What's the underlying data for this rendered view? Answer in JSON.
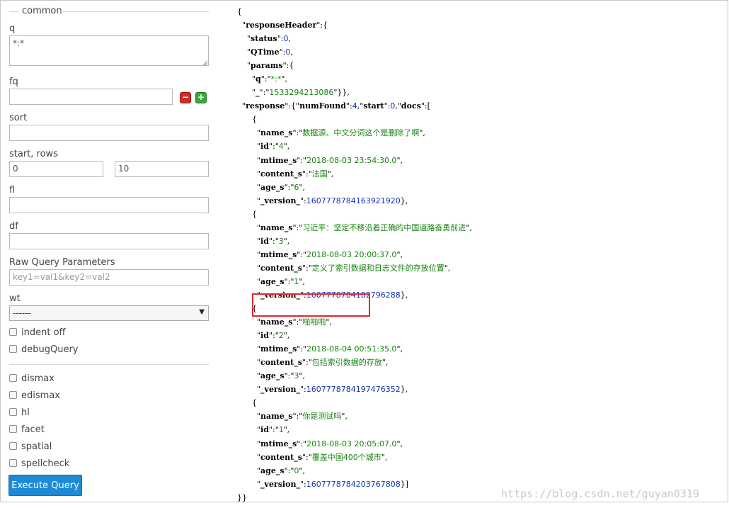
{
  "form": {
    "legend": "common",
    "q_label": "q",
    "q_value": "*:*",
    "fq_label": "fq",
    "fq_value": "",
    "sort_label": "sort",
    "sort_value": "",
    "start_rows_label": "start, rows",
    "start_value": "0",
    "rows_value": "10",
    "fl_label": "fl",
    "fl_value": "",
    "df_label": "df",
    "df_value": "",
    "raw_label": "Raw Query Parameters",
    "raw_placeholder": "key1=val1&key2=val2",
    "wt_label": "wt",
    "wt_value": "------",
    "indent_label": "indent off",
    "debug_label": "debugQuery",
    "dismax_label": "dismax",
    "edismax_label": "edismax",
    "hl_label": "hl",
    "facet_label": "facet",
    "spatial_label": "spatial",
    "spellcheck_label": "spellcheck",
    "execute_label": "Execute Query"
  },
  "response": {
    "status": "0",
    "qtime": "0",
    "params_q": "*:*",
    "params_underscore": "1533294213086",
    "numFound": "4",
    "start": "0",
    "docs": [
      {
        "name_s": "数据源、中文分词这个是删除了啊",
        "id": "4",
        "mtime_s": "2018-08-03 23:54:30.0",
        "content_s": "法国",
        "age_s": "6",
        "version": "1607778784163921920"
      },
      {
        "name_s": "习近平：坚定不移沿着正确的中国道路奋勇前进",
        "id": "3",
        "mtime_s": "2018-08-03 20:00:37.0",
        "content_s": "定义了索引数据和日志文件的存放位置",
        "age_s": "1",
        "version": "1607778784182796288"
      },
      {
        "name_s": "啪啪啪",
        "id": "2",
        "mtime_s": "2018-08-04 00:51:35.0",
        "content_s": "包括索引数据的存放",
        "age_s": "3",
        "version": "1607778784197476352"
      },
      {
        "name_s": "你是测试吗",
        "id": "1",
        "mtime_s": "2018-08-03 20:05:07.0",
        "content_s": "覆盖中国400个城市",
        "age_s": "0",
        "version": "1607778784203767808"
      }
    ]
  },
  "watermark": "https://blog.csdn.net/guyan0319",
  "colors": {
    "accent": "#1e8ad6",
    "json_string": "#17810f",
    "json_number": "#1234b4",
    "highlight": "#e8262b"
  }
}
